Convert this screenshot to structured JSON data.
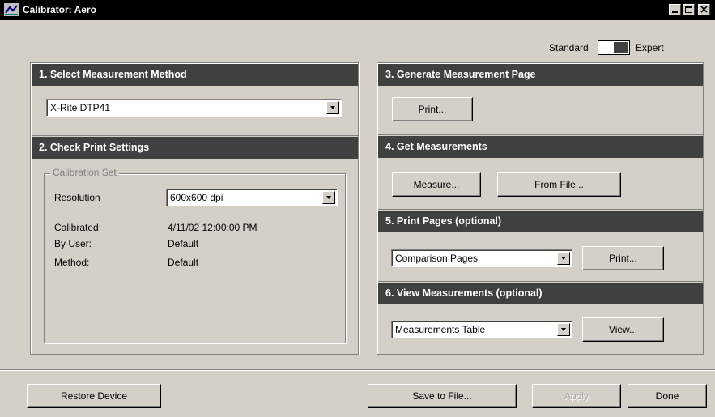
{
  "window": {
    "title": "Calibrator: Aero",
    "app_icon": "calibrator-icon",
    "controls": [
      "minimize-icon",
      "maximize-icon",
      "close-icon"
    ]
  },
  "mode": {
    "left_label": "Standard",
    "right_label": "Expert",
    "selected": "Expert"
  },
  "section1": {
    "title": "1. Select Measurement Method",
    "device": "X-Rite DTP41"
  },
  "section2": {
    "title": "2. Check Print Settings",
    "group_title": "Calibration Set",
    "resolution_label": "Resolution",
    "resolution_value": "600x600 dpi",
    "calibrated_label": "Calibrated:",
    "calibrated_value": "4/11/02 12:00:00 PM",
    "byuser_label": "By User:",
    "byuser_value": "Default",
    "method_label": "Method:",
    "method_value": "Default"
  },
  "section3": {
    "title": "3. Generate Measurement Page",
    "print_button": "Print..."
  },
  "section4": {
    "title": "4. Get Measurements",
    "measure_button": "Measure...",
    "fromfile_button": "From File..."
  },
  "section5": {
    "title": "5. Print Pages (optional)",
    "pages_value": "Comparison Pages",
    "print_button": "Print..."
  },
  "section6": {
    "title": "6. View Measurements (optional)",
    "view_value": "Measurements Table",
    "view_button": "View..."
  },
  "footer": {
    "restore_button": "Restore Device",
    "save_button": "Save to File...",
    "apply_button": "Apply",
    "done_button": "Done"
  }
}
